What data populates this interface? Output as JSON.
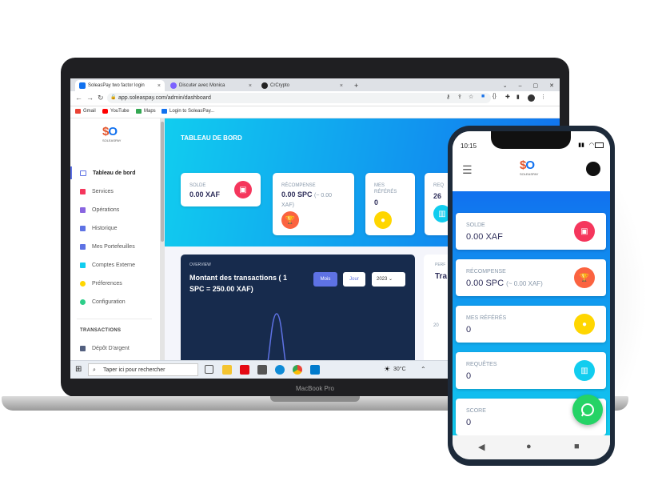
{
  "browser": {
    "tabs": [
      {
        "label": "SoleasPay two factor login",
        "active": true
      },
      {
        "label": "Discuter avec Monica",
        "active": false
      },
      {
        "label": "CrCrypto",
        "active": false
      }
    ],
    "new_tab": "+",
    "url": "app.soleaspay.com/admin/dashboard",
    "bookmarks": [
      "Gmail",
      "YouTube",
      "Maps",
      "Login to SoleasPay..."
    ]
  },
  "app": {
    "logo_text": "$O",
    "logo_sub": "SOLEASPAY",
    "sidebar": {
      "items": [
        {
          "label": "Tableau de bord",
          "icon": "monitor-icon",
          "color": "#5e72e4",
          "active": true
        },
        {
          "label": "Services",
          "icon": "box-icon",
          "color": "#f5365c",
          "active": false
        },
        {
          "label": "Opérations",
          "icon": "cube-icon",
          "color": "#8965e0",
          "active": false
        },
        {
          "label": "Historique",
          "icon": "document-icon",
          "color": "#5e72e4",
          "active": false
        },
        {
          "label": "Mes Portefeuilles",
          "icon": "wallet-icon",
          "color": "#5e72e4",
          "active": false
        },
        {
          "label": "Comptes Externe",
          "icon": "link-icon",
          "color": "#11cdef",
          "active": false
        },
        {
          "label": "Préferences",
          "icon": "user-icon",
          "color": "#ffd600",
          "active": false
        },
        {
          "label": "Configuration",
          "icon": "gear-icon",
          "color": "#2dce89",
          "active": false
        }
      ],
      "section_label": "TRANSACTIONS",
      "section_items": [
        {
          "label": "Dépôt D'argent",
          "icon": "deposit-icon",
          "color": "#525f7f"
        }
      ]
    },
    "page_title": "TABLEAU DE BORD",
    "cards": [
      {
        "label": "SOLDE",
        "value": "0.00 XAF",
        "icon": "wallet-icon",
        "color": "#f5365c"
      },
      {
        "label": "RÉCOMPENSE",
        "value": "0.00 SPC",
        "note": "(~ 0.00 XAF)",
        "icon": "trophy-icon",
        "color": "#fb6340"
      },
      {
        "label": "MES RÉFÉRÉS",
        "value": "0",
        "icon": "users-icon",
        "color": "#ffd600"
      },
      {
        "label": "REQ",
        "value": "26",
        "icon": "chart-icon",
        "color": "#11cdef"
      }
    ],
    "overview": {
      "label": "OVERVIEW",
      "title": "Montant des transactions ( 1 SPC = 250.00 XAF)",
      "btn_month": "Mois",
      "btn_day": "Jour",
      "year": "2023"
    },
    "perf_panel": {
      "label": "PERF",
      "title": "Tra",
      "tick": "20"
    }
  },
  "taskbar": {
    "search_placeholder": "Taper ici pour rechercher",
    "temperature": "30°C"
  },
  "laptop": {
    "brand": "MacBook Pro"
  },
  "phone": {
    "time": "10:15",
    "cards": [
      {
        "label": "SOLDE",
        "value": "0.00 XAF",
        "icon": "wallet-icon",
        "color": "#f5365c"
      },
      {
        "label": "RÉCOMPENSE",
        "value": "0.00 SPC",
        "note": "(~ 0.00 XAF)",
        "icon": "trophy-icon",
        "color": "#fb6340"
      },
      {
        "label": "MES RÉFÉRÉS",
        "value": "0",
        "icon": "users-icon",
        "color": "#ffd600"
      },
      {
        "label": "REQUÊTES",
        "value": "0",
        "icon": "chart-icon",
        "color": "#11cdef"
      },
      {
        "label": "SCORE",
        "value": "0",
        "icon": "",
        "color": ""
      }
    ]
  }
}
